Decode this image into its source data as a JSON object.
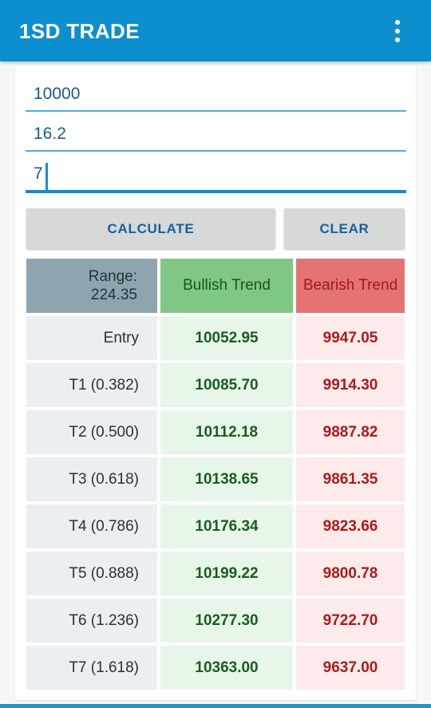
{
  "appbar": {
    "title": "1SD TRADE",
    "overflow_icon": "more-vert-icon",
    "background": "#0d8ecf",
    "title_color": "#ffffff"
  },
  "inputs": [
    {
      "name": "price-input",
      "value": "10000",
      "placeholder": "",
      "focused": false
    },
    {
      "name": "volatility-input",
      "value": "16.2",
      "placeholder": "",
      "focused": false
    },
    {
      "name": "days-input",
      "value": "7",
      "placeholder": "",
      "focused": true
    }
  ],
  "buttons": {
    "calculate_label": "CALCULATE",
    "clear_label": "CLEAR",
    "text_color": "#15609e",
    "background": "#d7d8d8"
  },
  "table": {
    "header": {
      "range_label": "Range:",
      "range_value": "224.35",
      "bullish": "Bullish Trend",
      "bearish": "Bearish Trend",
      "range_bg": "#8ea5af",
      "bullish_bg": "#81c784",
      "bearish_bg": "#e57373"
    },
    "rows": [
      {
        "label": "Entry",
        "bullish": "10052.95",
        "bearish": "9947.05"
      },
      {
        "label": "T1 (0.382)",
        "bullish": "10085.70",
        "bearish": "9914.30"
      },
      {
        "label": "T2 (0.500)",
        "bullish": "10112.18",
        "bearish": "9887.82"
      },
      {
        "label": "T3 (0.618)",
        "bullish": "10138.65",
        "bearish": "9861.35"
      },
      {
        "label": "T4 (0.786)",
        "bullish": "10176.34",
        "bearish": "9823.66"
      },
      {
        "label": "T5 (0.888)",
        "bullish": "10199.22",
        "bearish": "9800.78"
      },
      {
        "label": "T6 (1.236)",
        "bullish": "10277.30",
        "bearish": "9722.70"
      },
      {
        "label": "T7 (1.618)",
        "bullish": "10363.00",
        "bearish": "9637.00"
      }
    ]
  },
  "bottom_bar": {
    "color": "#2196c8"
  }
}
